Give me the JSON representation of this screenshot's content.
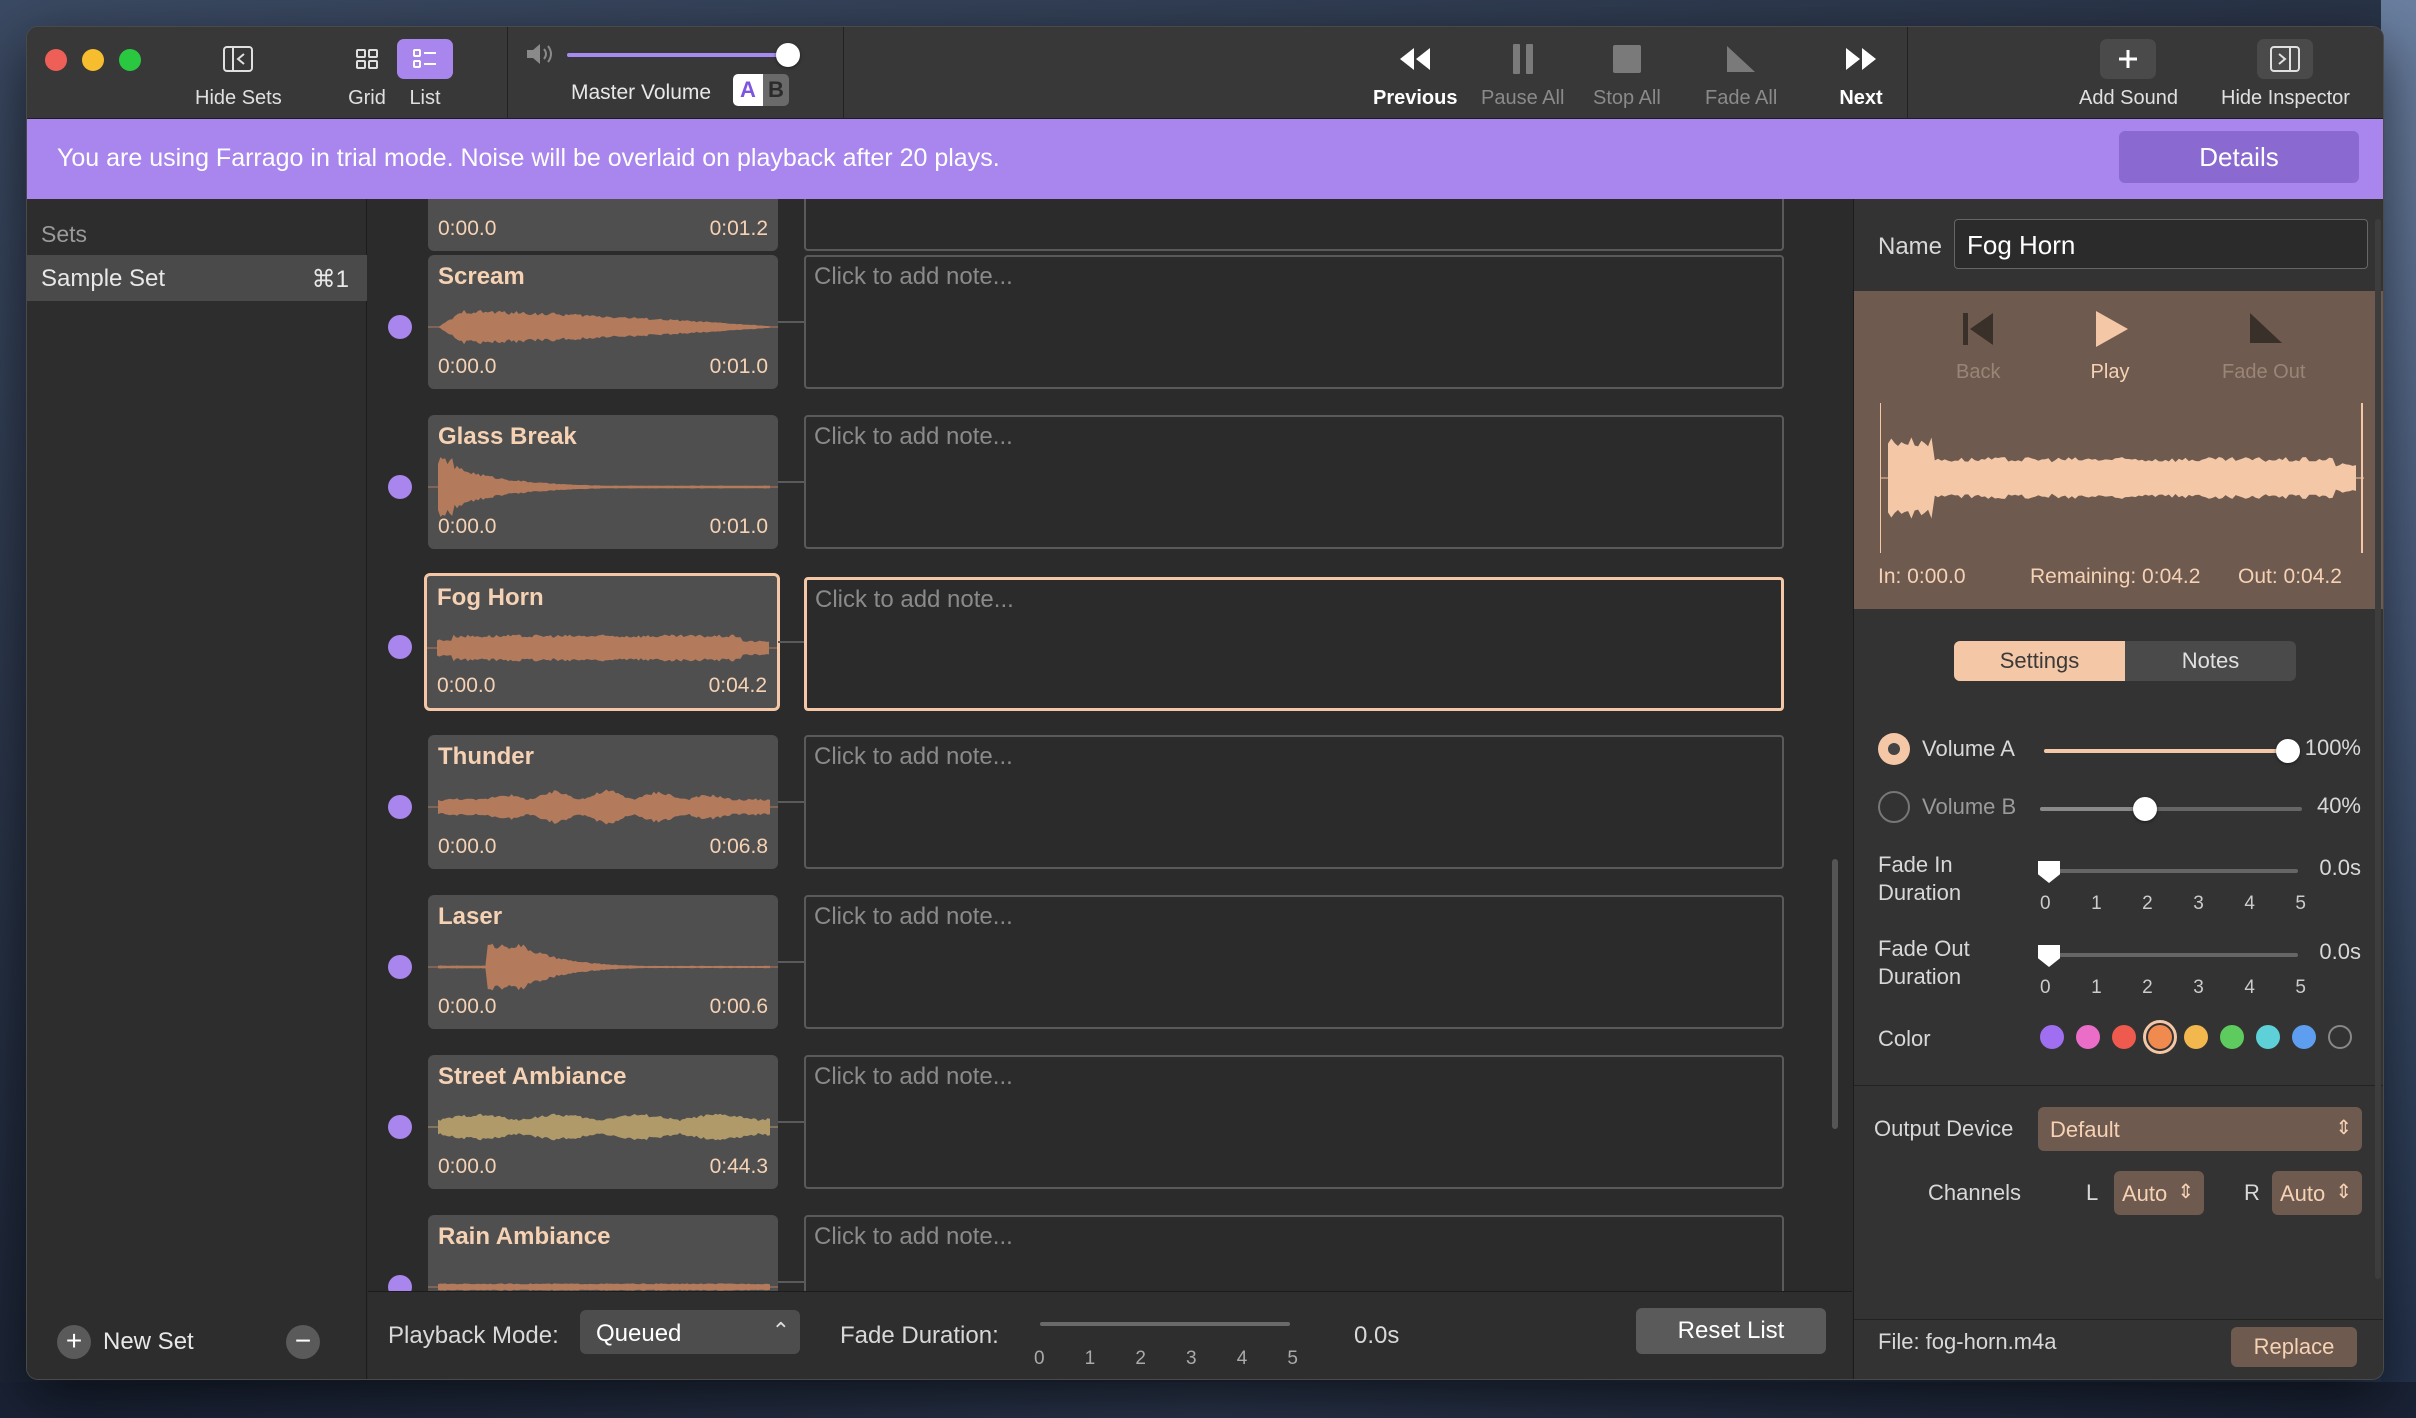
{
  "window": {
    "app": "Farrago"
  },
  "toolbar": {
    "hide_sets": "Hide Sets",
    "grid": "Grid",
    "list": "List",
    "master_volume": "Master Volume",
    "master_volume_level": 0.97,
    "ab_a": "A",
    "ab_b": "B",
    "previous": "Previous",
    "pause_all": "Pause All",
    "stop_all": "Stop All",
    "fade_all": "Fade All",
    "next": "Next",
    "add_sound": "Add Sound",
    "hide_inspector": "Hide Inspector"
  },
  "banner": {
    "text": "You are using Farrago in trial mode. Noise will be overlaid on playback after 20 plays.",
    "button": "Details"
  },
  "sidebar": {
    "title": "Sets",
    "items": [
      {
        "label": "Sample Set",
        "shortcut": "⌘1"
      }
    ],
    "new_set": "New Set",
    "add_icon": "+",
    "remove_icon": "−"
  },
  "sounds": [
    {
      "title": "",
      "start": "0:00.0",
      "end": "0:01.2",
      "note": "",
      "selected": false
    },
    {
      "title": "Scream",
      "start": "0:00.0",
      "end": "0:01.0",
      "note": "Click to add note...",
      "selected": false
    },
    {
      "title": "Glass Break",
      "start": "0:00.0",
      "end": "0:01.0",
      "note": "Click to add note...",
      "selected": false
    },
    {
      "title": "Fog Horn",
      "start": "0:00.0",
      "end": "0:04.2",
      "note": "Click to add note...",
      "selected": true
    },
    {
      "title": "Thunder",
      "start": "0:00.0",
      "end": "0:06.8",
      "note": "Click to add note...",
      "selected": false
    },
    {
      "title": "Laser",
      "start": "0:00.0",
      "end": "0:00.6",
      "note": "Click to add note...",
      "selected": false
    },
    {
      "title": "Street Ambiance",
      "start": "0:00.0",
      "end": "0:44.3",
      "note": "Click to add note...",
      "selected": false
    },
    {
      "title": "Rain Ambiance",
      "start": "",
      "end": "",
      "note": "Click to add note...",
      "selected": false
    }
  ],
  "bottombar": {
    "playback_mode_label": "Playback Mode:",
    "playback_mode_value": "Queued",
    "fade_duration_label": "Fade Duration:",
    "fade_duration_value": "0.0s",
    "ticks": [
      "0",
      "1",
      "2",
      "3",
      "4",
      "5"
    ],
    "reset_list": "Reset List"
  },
  "inspector": {
    "name_label": "Name",
    "name_value": "Fog Horn",
    "back": "Back",
    "play": "Play",
    "fade_out": "Fade Out",
    "in_time": "In: 0:00.0",
    "remaining": "Remaining: 0:04.2",
    "out_time": "Out: 0:04.2",
    "tab_settings": "Settings",
    "tab_notes": "Notes",
    "volume_a_label": "Volume A",
    "volume_a_value": "100%",
    "volume_a_level": 1.0,
    "volume_b_label": "Volume B",
    "volume_b_value": "40%",
    "volume_b_level": 0.4,
    "fade_in_label_1": "Fade In",
    "fade_in_label_2": "Duration",
    "fade_in_value": "0.0s",
    "fade_out_label_1": "Fade Out",
    "fade_out_label_2": "Duration",
    "fade_out_value": "0.0s",
    "ticks": [
      "0",
      "1",
      "2",
      "3",
      "4",
      "5"
    ],
    "color_label": "Color",
    "colors": [
      "#a06ef0",
      "#ea6ec8",
      "#ee5a4e",
      "#f08a4e",
      "#f2b84e",
      "#5ecb5e",
      "#5ed0d8",
      "#5e9ef0",
      "none"
    ],
    "selected_color_index": 3,
    "output_device_label": "Output Device",
    "output_device_value": "Default",
    "channels_label": "Channels",
    "l_label": "L",
    "l_value": "Auto",
    "r_label": "R",
    "r_value": "Auto",
    "file_label": "File: fog-horn.m4a",
    "replace": "Replace"
  },
  "colors": {
    "accent": "#a886ee",
    "peach": "#f4c7a6",
    "waveform": "#b37a5c",
    "street_waveform": "#b09a6a"
  }
}
